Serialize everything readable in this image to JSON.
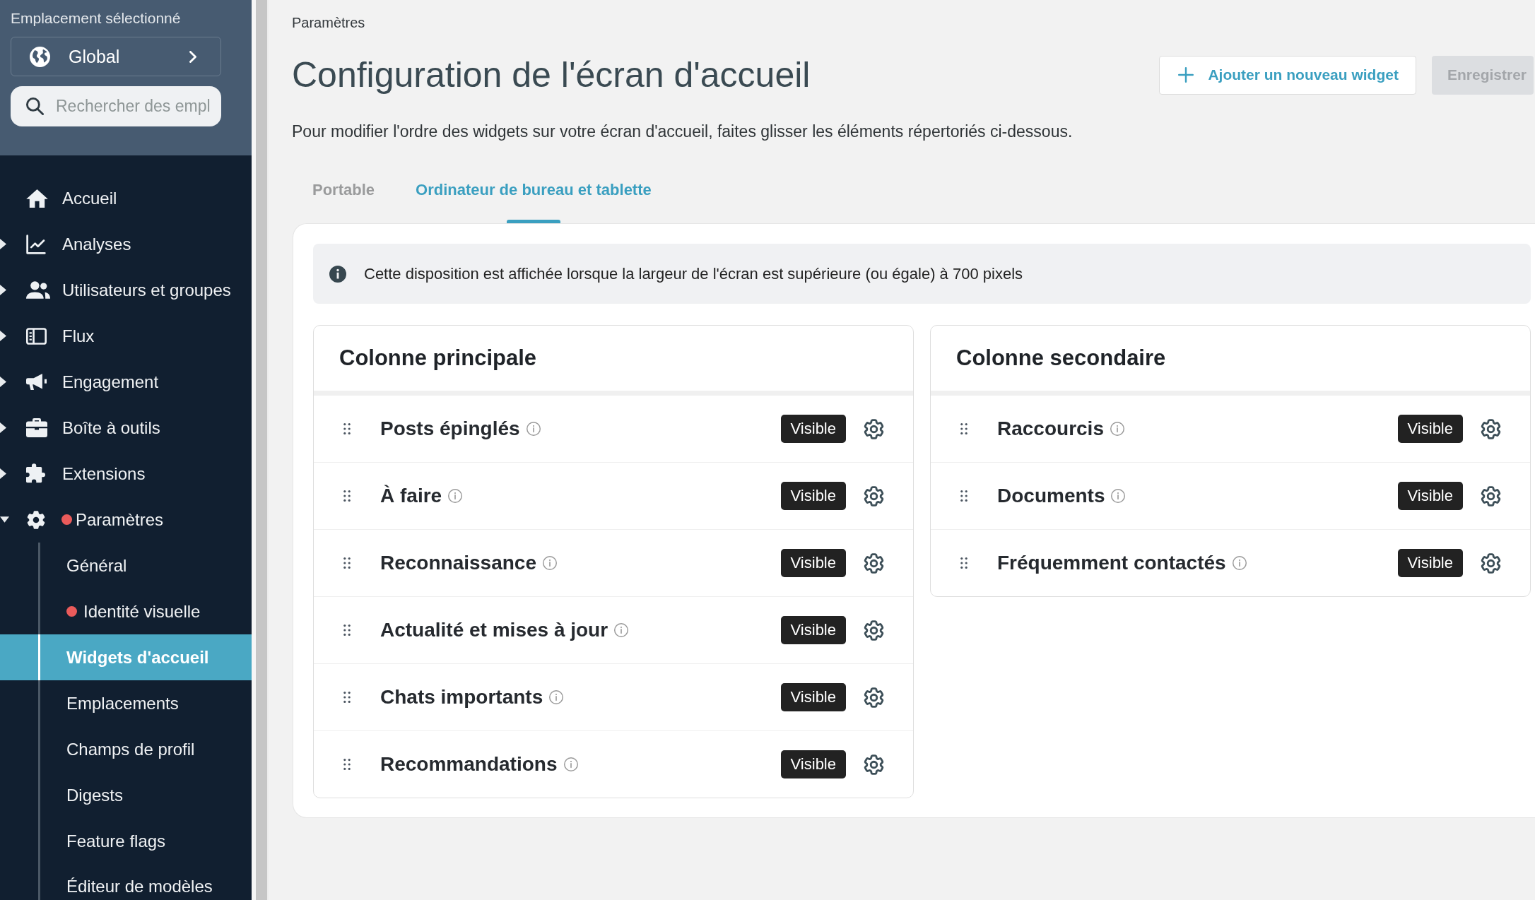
{
  "sidebar": {
    "location_label": "Emplacement sélectionné",
    "location_button": {
      "label": "Global"
    },
    "search": {
      "placeholder": "Rechercher des empl"
    },
    "nav": [
      {
        "label": "Accueil",
        "kind": "link",
        "selected": false,
        "alert": false
      },
      {
        "label": "Analyses",
        "kind": "group",
        "expanded": false,
        "selected": false,
        "alert": false
      },
      {
        "label": "Utilisateurs et groupes",
        "kind": "group",
        "expanded": false,
        "selected": false,
        "alert": false
      },
      {
        "label": "Flux",
        "kind": "group",
        "expanded": false,
        "selected": false,
        "alert": false
      },
      {
        "label": "Engagement",
        "kind": "group",
        "expanded": false,
        "selected": false,
        "alert": false
      },
      {
        "label": "Boîte à outils",
        "kind": "group",
        "expanded": false,
        "selected": false,
        "alert": false
      },
      {
        "label": "Extensions",
        "kind": "group",
        "expanded": false,
        "selected": false,
        "alert": false
      },
      {
        "label": "Paramètres",
        "kind": "group",
        "expanded": true,
        "selected": false,
        "alert": true,
        "children": [
          {
            "label": "Général",
            "selected": false,
            "alert": false
          },
          {
            "label": "Identité visuelle",
            "selected": false,
            "alert": true
          },
          {
            "label": "Widgets d'accueil",
            "selected": true,
            "alert": false
          },
          {
            "label": "Emplacements",
            "selected": false,
            "alert": false
          },
          {
            "label": "Champs de profil",
            "selected": false,
            "alert": false
          },
          {
            "label": "Digests",
            "selected": false,
            "alert": false
          },
          {
            "label": "Feature flags",
            "selected": false,
            "alert": false
          },
          {
            "label": "Éditeur de modèles",
            "selected": false,
            "alert": false
          }
        ]
      }
    ]
  },
  "header": {
    "breadcrumb": "Paramètres",
    "title": "Configuration de l'écran d'accueil",
    "buttons": [
      {
        "label": "Ajouter un nouveau widget",
        "kind": "add",
        "disabled": false
      },
      {
        "label": "Enregistrer",
        "kind": "save",
        "disabled": true
      }
    ],
    "description": "Pour modifier l'ordre des widgets sur votre écran d'accueil, faites glisser les éléments répertoriés ci-dessous."
  },
  "tabs": [
    {
      "label": "Portable",
      "selected": false
    },
    {
      "label": "Ordinateur de bureau et tablette",
      "selected": true
    }
  ],
  "layout_panel": {
    "notice": "Cette disposition est affichée lorsque la largeur de l'écran est supérieure (ou égale) à 700 pixels",
    "columns": [
      {
        "title": "Colonne principale",
        "widgets": [
          {
            "name": "Posts épinglés",
            "status": "Visible"
          },
          {
            "name": "À faire",
            "status": "Visible"
          },
          {
            "name": "Reconnaissance",
            "status": "Visible"
          },
          {
            "name": "Actualité et mises à jour",
            "status": "Visible"
          },
          {
            "name": "Chats importants",
            "status": "Visible"
          },
          {
            "name": "Recommandations",
            "status": "Visible"
          }
        ]
      },
      {
        "title": "Colonne secondaire",
        "widgets": [
          {
            "name": "Raccourcis",
            "status": "Visible"
          },
          {
            "name": "Documents",
            "status": "Visible"
          },
          {
            "name": "Fréquemment contactés",
            "status": "Visible"
          }
        ]
      }
    ]
  }
}
